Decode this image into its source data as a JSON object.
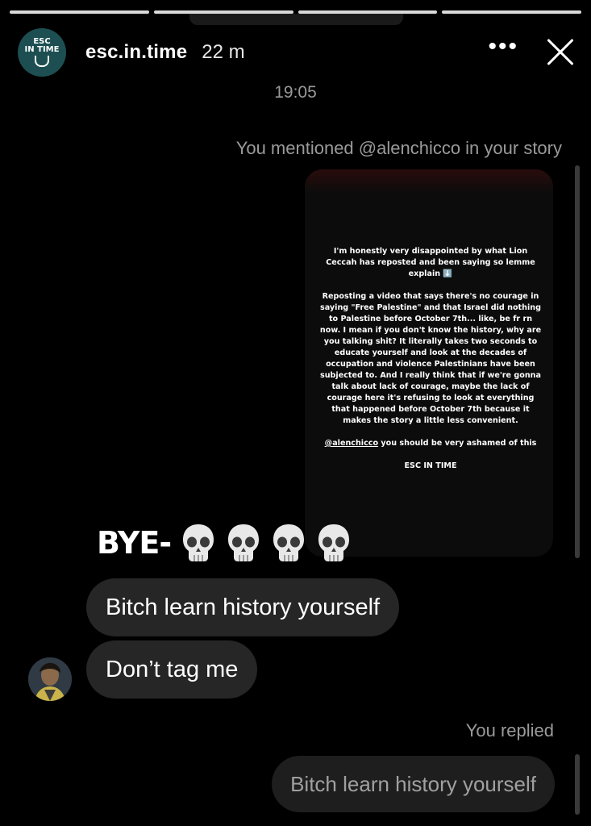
{
  "progress": {
    "segments": 4
  },
  "header": {
    "logo_line1": "ESC",
    "logo_line2": "IN TIME",
    "username": "esc.in.time",
    "time_ago": "22 m",
    "more_label": "•••"
  },
  "chat": {
    "timestamp": "19:05",
    "mention_note": "You mentioned @alenchicco in your story",
    "story": {
      "para1": "I'm honestly very disappointed by what Lion Ceccah has reposted and been saying so lemme explain ⬇️",
      "para2": "Reposting a video that says there's no courage in saying \"Free Palestine\" and that Israel did nothing to Palestine before October 7th... like, be fr rn now. I mean if you don't know the history, why are you talking shit? It literally takes two seconds to educate yourself and look at the decades of occupation and violence Palestinians have been subjected to. And I really think that if we're gonna talk about lack of courage, maybe the lack of courage here  it's refusing to look at everything that happened before October 7th because it makes the story a little less convenient.",
      "mention": "@alenchicco",
      "para3_rest": " you should be very ashamed of this",
      "signature": "ESC IN TIME"
    },
    "reaction_text": "BYE-",
    "reaction_emoji": [
      "skull-emoji",
      "skull-emoji",
      "skull-emoji",
      "skull-emoji"
    ],
    "messages": [
      {
        "from": "them",
        "text": "Bitch learn history yourself"
      },
      {
        "from": "them",
        "text": "Don’t tag me"
      }
    ],
    "replied_note": "You replied",
    "reply_quote": "Bitch learn history yourself"
  }
}
